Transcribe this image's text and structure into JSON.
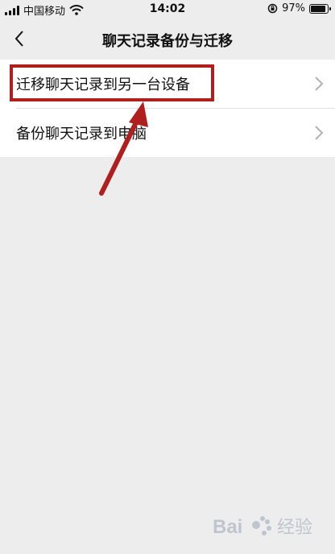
{
  "status_bar": {
    "carrier": "中国移动",
    "time": "14:02",
    "battery_text": "97%",
    "battery_level": 0.97
  },
  "nav": {
    "title": "聊天记录备份与迁移"
  },
  "list": {
    "items": [
      {
        "label": "迁移聊天记录到另一台设备"
      },
      {
        "label": "备份聊天记录到电脑"
      }
    ]
  },
  "annotation": {
    "color": "#b01e1e"
  },
  "watermark": {
    "text": "Bai 经验"
  }
}
